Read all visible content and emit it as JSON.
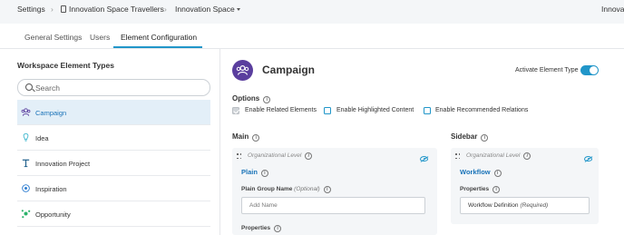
{
  "breadcrumb": {
    "settings": "Settings",
    "workspace": "Innovation Space Travellers",
    "space": "Innovation Space",
    "cut_off": "Innova"
  },
  "tabs": [
    {
      "label": "General Settings"
    },
    {
      "label": "Users"
    },
    {
      "label": "Element Configuration"
    }
  ],
  "left_panel": {
    "title": "Workspace Element Types",
    "search_placeholder": "Search",
    "element_types": [
      {
        "label": "Campaign",
        "icon": "campaign-icon",
        "active": true
      },
      {
        "label": "Idea",
        "icon": "lightbulb-icon"
      },
      {
        "label": "Innovation Project",
        "icon": "project-icon"
      },
      {
        "label": "Inspiration",
        "icon": "inspiration-icon"
      },
      {
        "label": "Opportunity",
        "icon": "opportunity-icon"
      }
    ]
  },
  "header": {
    "title": "Campaign",
    "activate_label": "Activate Element Type"
  },
  "options": {
    "label": "Options",
    "checkboxes": [
      {
        "label": "Enable Related Elements",
        "checked": true
      },
      {
        "label": "Enable Highlighted Content",
        "checked": false
      },
      {
        "label": "Enable Recommended Relations",
        "checked": false
      }
    ]
  },
  "main": {
    "label": "Main",
    "org_level": "Organizational Level",
    "heading": "Plain",
    "group_name_label": "Plain Group Name",
    "group_name_optional": "(Optional)",
    "group_name_placeholder": "Add Name",
    "properties_label": "Properties"
  },
  "sidebar": {
    "label": "Sidebar",
    "org_level": "Organizational Level",
    "heading": "Workflow",
    "properties_label": "Properties",
    "field_value": "Workflow Definition",
    "field_required": "(Required)"
  },
  "colors": {
    "accent": "#2196c9",
    "link": "#1a73b8",
    "avatar": "#5a3e9e",
    "active_bg": "#e3eff8"
  }
}
